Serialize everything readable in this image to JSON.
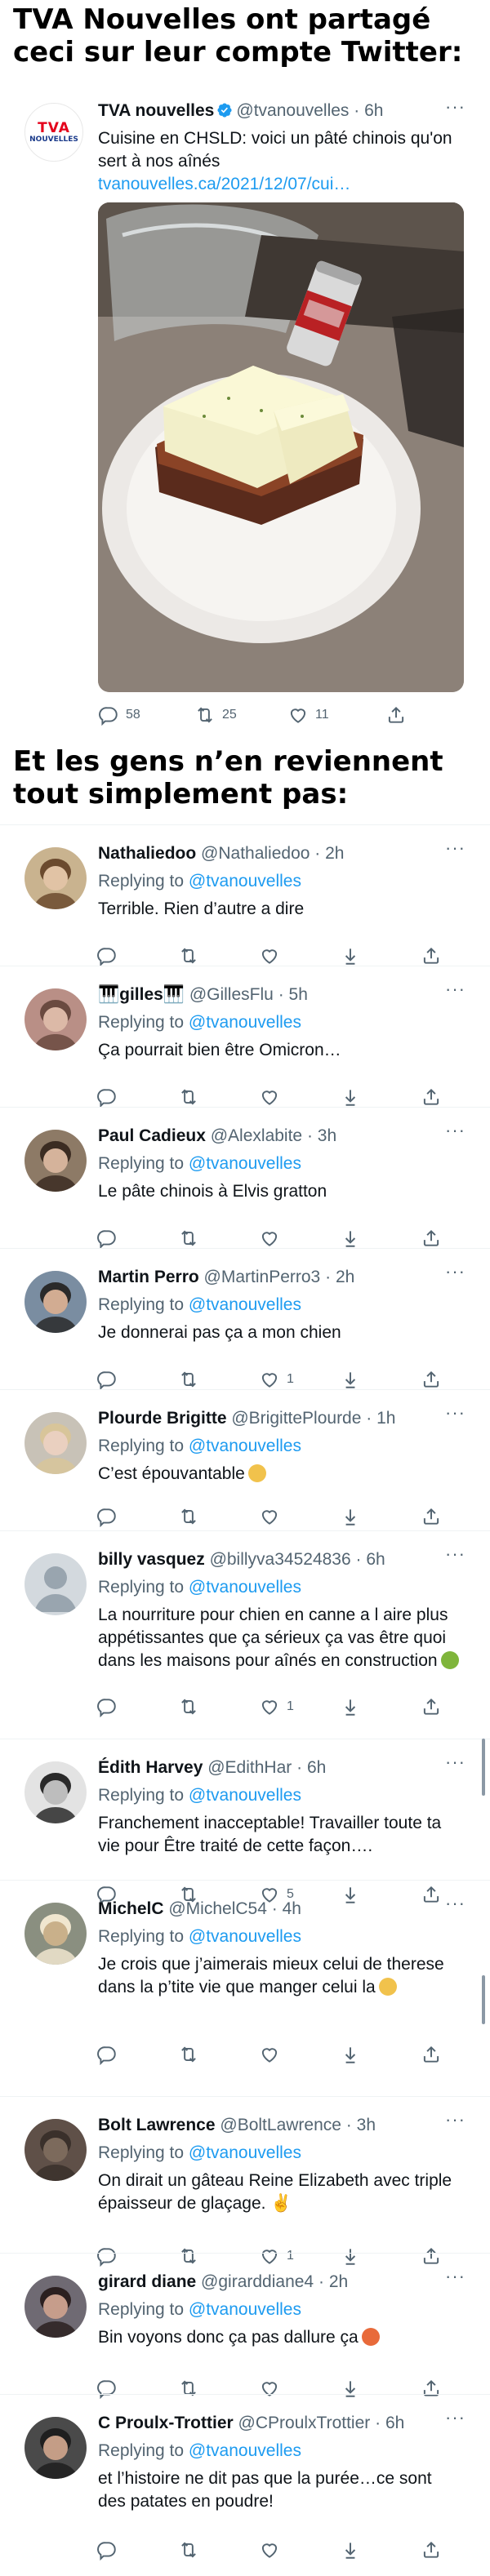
{
  "headline_top": "TVA Nouvelles ont partagé ceci sur leur compte Twitter:",
  "headline_mid": "Et les gens n’en reviennent tout simplement pas:",
  "original": {
    "avatar_line1": "TVA",
    "avatar_line2": "NOUVELLES",
    "name": "TVA nouvelles",
    "handle": "@tvanouvelles",
    "dot": "·",
    "time": "6h",
    "text": "Cuisine en CHSLD: voici un pâté chinois qu'on sert à nos aînés",
    "link": "tvanouvelles.ca/2021/12/07/cui…",
    "replies": "58",
    "retweets": "25",
    "likes": "11",
    "more": "···",
    "verified_icon": "verified-badge-icon",
    "photo_icon": "food-photo"
  },
  "replying_to_label": "Replying to",
  "replying_to_handle": "@tvanouvelles",
  "replies": [
    {
      "name": "Nathaliedoo",
      "handle": "@Nathaliedoo",
      "time": "2h",
      "text": "Terrible. Rien d’autre a dire",
      "likes": ""
    },
    {
      "name": "🎹gilles🎹",
      "handle": "@GillesFlu",
      "time": "5h",
      "text": "Ça pourrait bien être Omicron…",
      "likes": ""
    },
    {
      "name": "Paul Cadieux",
      "handle": "@Alexlabite",
      "time": "3h",
      "text": "Le pâte chinois à Elvis gratton",
      "likes": ""
    },
    {
      "name": "Martin Perro",
      "handle": "@MartinPerro3",
      "time": "2h",
      "text": "Je donnerai pas ça a mon chien",
      "likes": "1"
    },
    {
      "name": "Plourde Brigitte",
      "handle": "@BrigittePlourde",
      "time": "1h",
      "text": "C’est épouvantable",
      "likes": ""
    },
    {
      "name": "billy vasquez",
      "handle": "@billyva34524836",
      "time": "6h",
      "text": "La nourriture pour chien en canne a l aire plus appétissantes que ça sérieux ça vas être quoi dans les maisons pour aînés en construction",
      "likes": "1"
    },
    {
      "name": "Édith Harvey",
      "handle": "@EdithHar",
      "time": "6h",
      "text": "Franchement inacceptable! Travailler toute ta vie pour Être traité de cette façon….",
      "likes": "5"
    },
    {
      "name": "MichelC",
      "handle": "@MichelC54",
      "time": "4h",
      "text": "Je crois que j’aimerais mieux celui de therese dans la p’tite vie que manger celui la",
      "likes": ""
    },
    {
      "name": "Bolt Lawrence",
      "handle": "@BoltLawrence",
      "time": "3h",
      "text": "On dirait un gâteau Reine Elizabeth avec triple épaisseur de glaçage. ✌",
      "likes": "1"
    },
    {
      "name": "girard diane",
      "handle": "@girarddiane4",
      "time": "2h",
      "text": "Bin voyons donc ça pas dallure ça",
      "likes": ""
    },
    {
      "name": "C Proulx-Trottier",
      "handle": "@CProulxTrottier",
      "time": "6h",
      "text": "et l’histoire ne dit pas que la purée…ce sont des patates en poudre!",
      "likes": ""
    }
  ],
  "colors": {
    "link": "#1d9bf0",
    "muted": "#536471",
    "text": "#0f1419",
    "divider": "#eff3f4",
    "tva_red": "#e4001b"
  }
}
